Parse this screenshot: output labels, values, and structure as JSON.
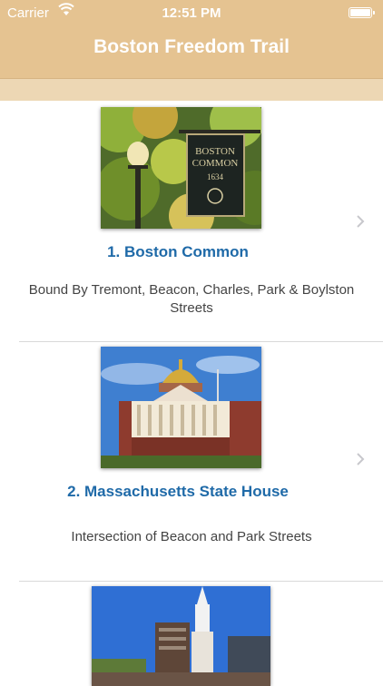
{
  "status_bar": {
    "carrier": "Carrier",
    "time": "12:51 PM",
    "battery_level": 1.0
  },
  "nav": {
    "title": "Boston Freedom Trail"
  },
  "colors": {
    "header": "#e5c391",
    "subheader": "#edd7b4",
    "title_link": "#1f6aa8",
    "body_text": "#444444"
  },
  "sites": [
    {
      "title": "1. Boston Common",
      "address": "Bound By Tremont, Beacon, Charles, Park & Boylston Streets",
      "image": {
        "sign_line1": "BOSTON",
        "sign_line2": "COMMON",
        "sign_year": "1634"
      }
    },
    {
      "title": "2. Massachusetts State House",
      "address": "Intersection of Beacon and Park Streets"
    },
    {
      "title": "",
      "address": ""
    }
  ]
}
